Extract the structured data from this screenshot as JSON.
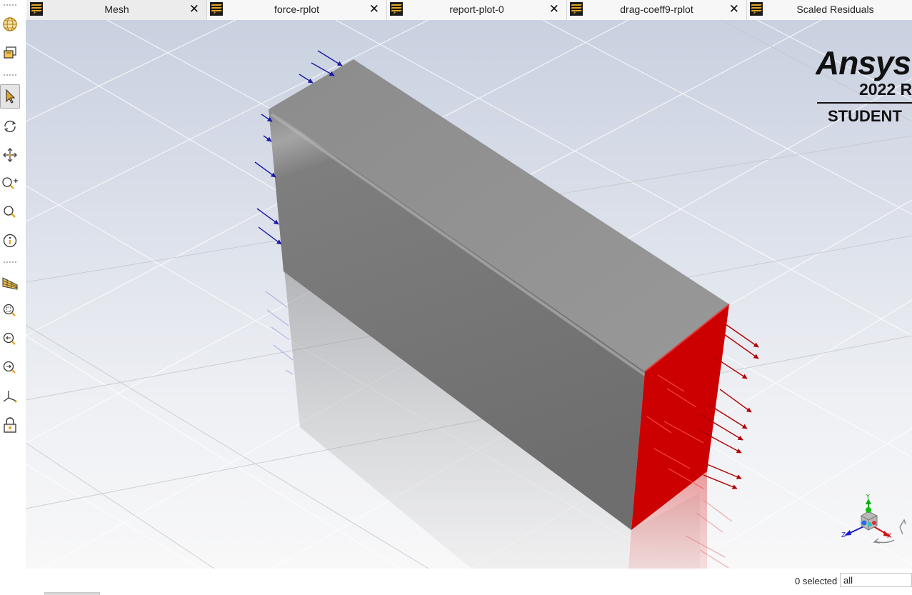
{
  "tabs": [
    {
      "label": "Mesh",
      "icon": "fluent-window-icon",
      "active": true
    },
    {
      "label": "force-rplot",
      "icon": "fluent-window-icon",
      "active": false
    },
    {
      "label": "report-plot-0",
      "icon": "fluent-window-icon",
      "active": false
    },
    {
      "label": "drag-coeff9-rplot",
      "icon": "fluent-window-icon",
      "active": false
    },
    {
      "label": "Scaled Residuals",
      "icon": "fluent-window-icon",
      "active": false
    }
  ],
  "tab_icon_letter": "F",
  "tab_close_glyph": "✕",
  "toolbar": [
    {
      "icon": "mesh-sphere-icon"
    },
    {
      "icon": "mesh-display-icon"
    },
    {
      "icon": "select-pointer-icon",
      "active": true
    },
    {
      "icon": "rotate-icon"
    },
    {
      "icon": "pan-icon"
    },
    {
      "icon": "zoom-in-icon"
    },
    {
      "icon": "zoom-icon"
    },
    {
      "icon": "probe-info-icon"
    },
    {
      "icon": "mesh-plane-icon"
    },
    {
      "icon": "zoom-to-box-icon"
    },
    {
      "icon": "zoom-out-icon"
    },
    {
      "icon": "fit-to-window-icon"
    },
    {
      "icon": "view-axes-icon"
    },
    {
      "icon": "lock-icon"
    }
  ],
  "logo": {
    "brand": "Ansys",
    "version": "2022 R",
    "edition": "STUDENT"
  },
  "triad": {
    "y": "Y",
    "z": "Z",
    "x": "X"
  },
  "status": {
    "selected": "0 selected",
    "filter_value": "all"
  },
  "colors": {
    "outlet_face": "#cc0000",
    "inlet_arrows": "#1a1aa8",
    "outlet_arrows": "#b00000",
    "logo_accent": "#e3a528"
  }
}
